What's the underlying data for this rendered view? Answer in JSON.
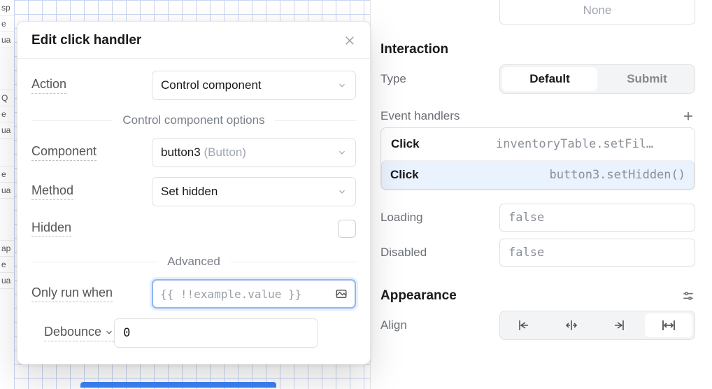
{
  "canvas": {
    "cell_fragments": [
      "sp",
      "e",
      "ua",
      "Q",
      "e",
      "ua",
      "e",
      "ua",
      "ap",
      "e",
      "ua"
    ]
  },
  "modal": {
    "title": "Edit click handler",
    "action_label": "Action",
    "action_value": "Control component",
    "options_divider": "Control component options",
    "component_label": "Component",
    "component_value": "button3",
    "component_type": "(Button)",
    "method_label": "Method",
    "method_value": "Set hidden",
    "hidden_label": "Hidden",
    "advanced_divider": "Advanced",
    "only_run_label": "Only run when",
    "only_run_placeholder": "{{ !!example.value }}",
    "debounce_label": "Debounce",
    "debounce_value": "0"
  },
  "inspector": {
    "none_value": "None",
    "section_interaction": "Interaction",
    "type_label": "Type",
    "type_options": [
      "Default",
      "Submit"
    ],
    "type_selected": "Default",
    "eh_label": "Event handlers",
    "handlers": [
      {
        "event": "Click",
        "code": "inventoryTable.setFil…",
        "selected": false
      },
      {
        "event": "Click",
        "code": "button3.setHidden()",
        "selected": true
      }
    ],
    "loading_label": "Loading",
    "loading_value": "false",
    "disabled_label": "Disabled",
    "disabled_value": "false",
    "section_appearance": "Appearance",
    "align_label": "Align"
  }
}
